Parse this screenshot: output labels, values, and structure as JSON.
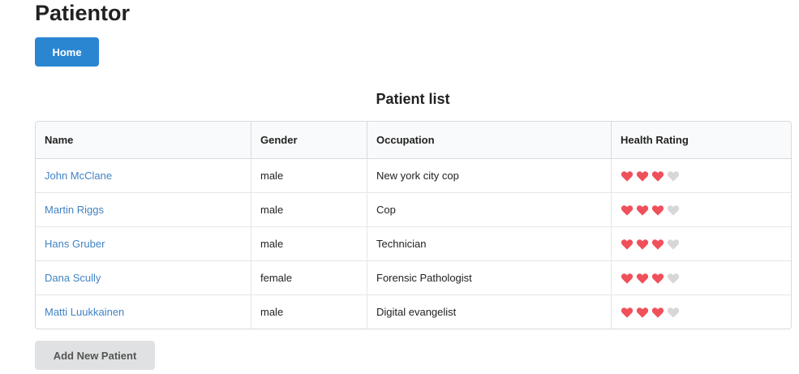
{
  "app": {
    "title": "Patientor"
  },
  "nav": {
    "home_label": "Home"
  },
  "list": {
    "title": "Patient list",
    "columns": [
      "Name",
      "Gender",
      "Occupation",
      "Health Rating"
    ],
    "rows": [
      {
        "name": "John McClane",
        "gender": "male",
        "occupation": "New york city cop",
        "health_rating": 3,
        "health_max": 4
      },
      {
        "name": "Martin Riggs",
        "gender": "male",
        "occupation": "Cop",
        "health_rating": 3,
        "health_max": 4
      },
      {
        "name": "Hans Gruber",
        "gender": "male",
        "occupation": "Technician",
        "health_rating": 3,
        "health_max": 4
      },
      {
        "name": "Dana Scully",
        "gender": "female",
        "occupation": "Forensic Pathologist",
        "health_rating": 3,
        "health_max": 4
      },
      {
        "name": "Matti Luukkainen",
        "gender": "male",
        "occupation": "Digital evangelist",
        "health_rating": 3,
        "health_max": 4
      }
    ]
  },
  "actions": {
    "add_label": "Add New Patient"
  },
  "colors": {
    "primary": "#2b86d2",
    "link": "#4183c4",
    "heart_filled": "#f0505a",
    "heart_empty": "#d7d7d7"
  },
  "icons": {
    "rating": "heart-icon"
  }
}
